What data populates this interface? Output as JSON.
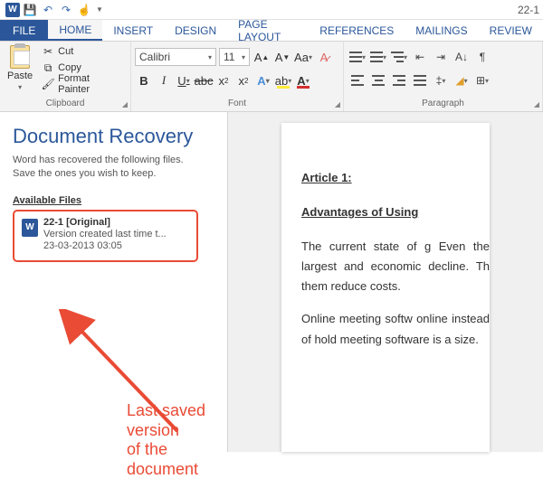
{
  "qat": {
    "doc_name": "22-1"
  },
  "tabs": {
    "file": "FILE",
    "home": "HOME",
    "insert": "INSERT",
    "design": "DESIGN",
    "page_layout": "PAGE LAYOUT",
    "references": "REFERENCES",
    "mailings": "MAILINGS",
    "review": "REVIEW"
  },
  "ribbon": {
    "clipboard": {
      "paste": "Paste",
      "cut": "Cut",
      "copy": "Copy",
      "format_painter": "Format Painter",
      "label": "Clipboard"
    },
    "font": {
      "family": "Calibri",
      "size": "11",
      "label": "Font"
    },
    "paragraph": {
      "label": "Paragraph"
    }
  },
  "recovery": {
    "title": "Document Recovery",
    "subtitle1": "Word has recovered the following files.",
    "subtitle2": "Save the ones you wish to keep.",
    "section_label": "Available Files",
    "item": {
      "name": "22-1  [Original]",
      "desc": "Version created last time t...",
      "date": "23-03-2013 03:05"
    }
  },
  "annotation": {
    "line1": "Last saved version",
    "line2": "of the document"
  },
  "document": {
    "h1": "Article 1:",
    "h2": "Advantages of Using ",
    "p1": "The current state of g Even the largest and economic decline. Th them reduce costs.",
    "p2": "Online meeting softw online instead of hold meeting software is a size."
  }
}
